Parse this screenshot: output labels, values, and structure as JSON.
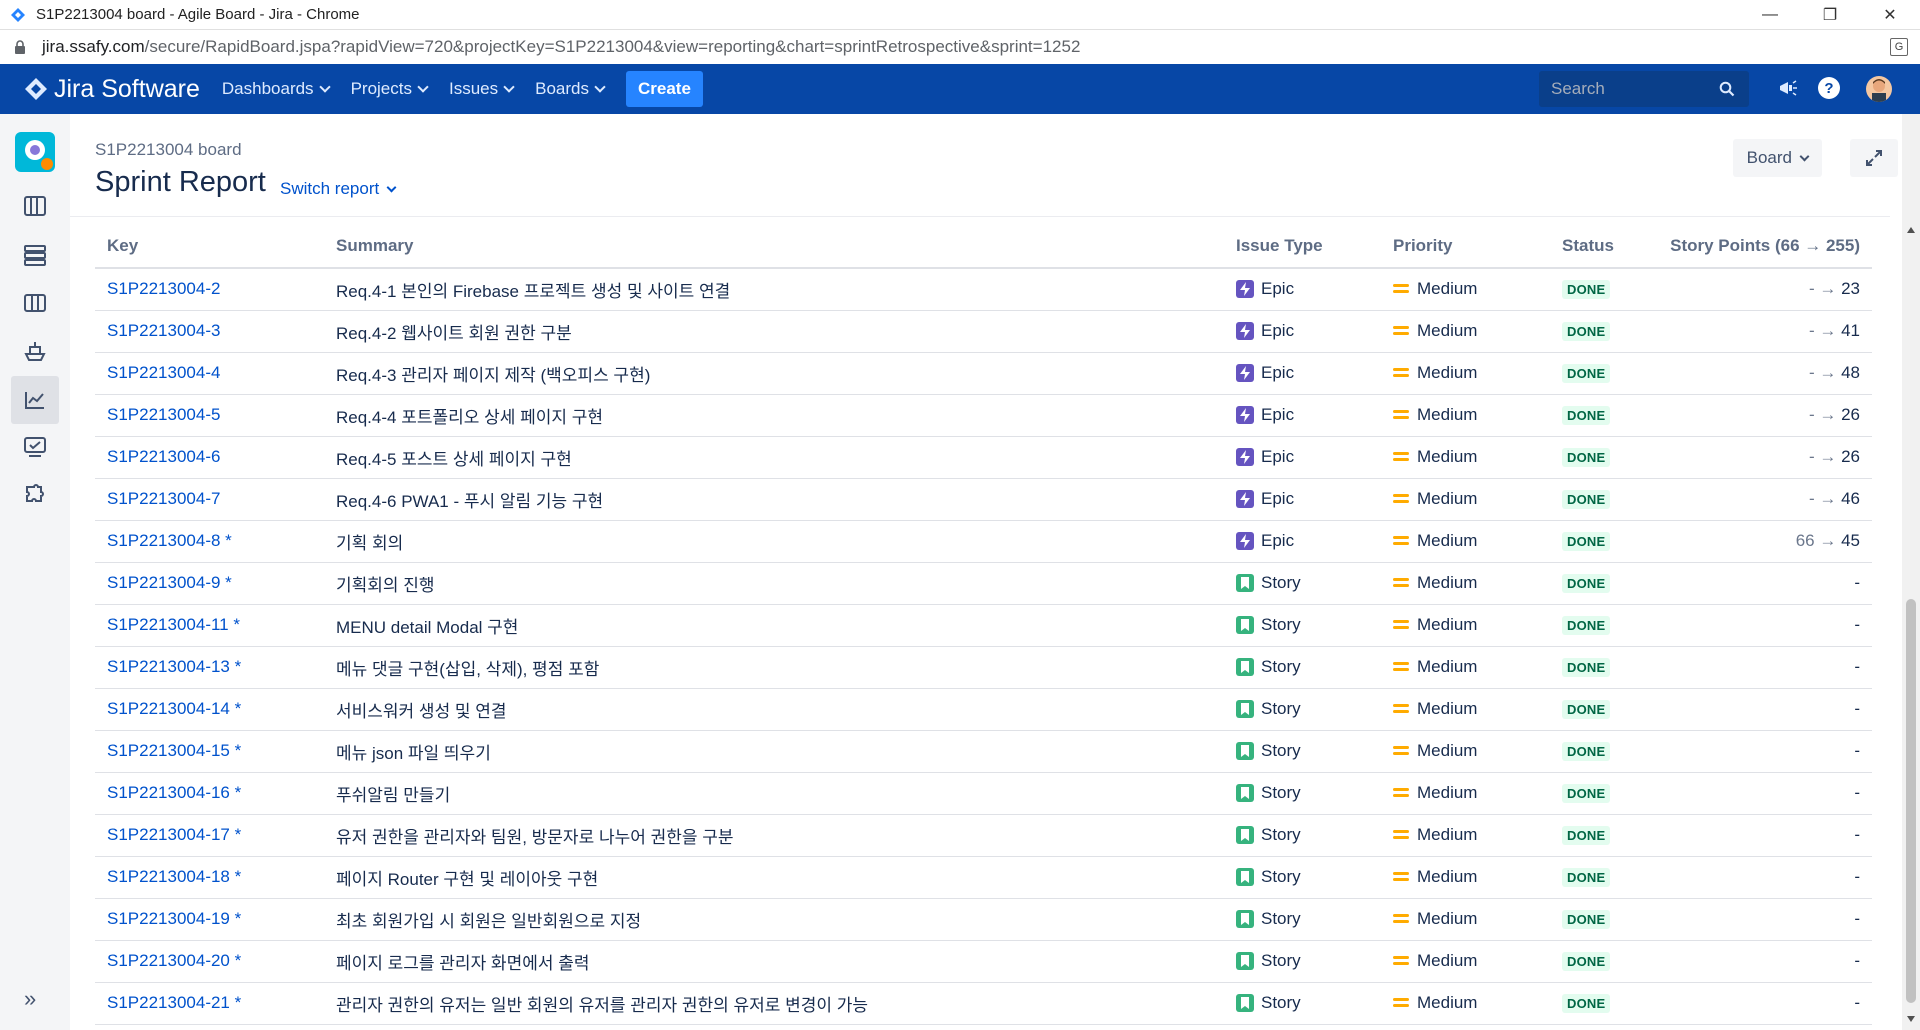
{
  "browser": {
    "window_title": "S1P2213004 board - Agile Board - Jira - Chrome",
    "url_domain": "jira.ssafy.com",
    "url_path": "/secure/RapidBoard.jspa?rapidView=720&projectKey=S1P2213004&view=reporting&chart=sprintRetrospective&sprint=1252"
  },
  "topnav": {
    "logo": "Jira Software",
    "items": [
      "Dashboards",
      "Projects",
      "Issues",
      "Boards"
    ],
    "create_label": "Create",
    "search_placeholder": "Search"
  },
  "header": {
    "board_name": "S1P2213004 board",
    "title": "Sprint Report",
    "switch_report": "Switch report",
    "board_button": "Board"
  },
  "table": {
    "columns": [
      "Key",
      "Summary",
      "Issue Type",
      "Priority",
      "Status",
      "Story Points (66 → 255)"
    ],
    "rows": [
      {
        "key": "S1P2213004-2",
        "summary": "Req.4-1 본인의 Firebase 프로젝트 생성 및 사이트 연결",
        "type": "Epic",
        "priority": "Medium",
        "status": "DONE",
        "points_from": "- →",
        "points_to": "23"
      },
      {
        "key": "S1P2213004-3",
        "summary": "Req.4-2 웹사이트 회원 권한 구분",
        "type": "Epic",
        "priority": "Medium",
        "status": "DONE",
        "points_from": "- →",
        "points_to": "41"
      },
      {
        "key": "S1P2213004-4",
        "summary": "Req.4-3 관리자 페이지 제작 (백오피스 구현)",
        "type": "Epic",
        "priority": "Medium",
        "status": "DONE",
        "points_from": "- →",
        "points_to": "48"
      },
      {
        "key": "S1P2213004-5",
        "summary": "Req.4-4 포트폴리오 상세 페이지 구현",
        "type": "Epic",
        "priority": "Medium",
        "status": "DONE",
        "points_from": "- →",
        "points_to": "26"
      },
      {
        "key": "S1P2213004-6",
        "summary": "Req.4-5 포스트 상세 페이지 구현",
        "type": "Epic",
        "priority": "Medium",
        "status": "DONE",
        "points_from": "- →",
        "points_to": "26"
      },
      {
        "key": "S1P2213004-7",
        "summary": "Req.4-6 PWA1 - 푸시 알림 기능 구현",
        "type": "Epic",
        "priority": "Medium",
        "status": "DONE",
        "points_from": "- →",
        "points_to": "46"
      },
      {
        "key": "S1P2213004-8 *",
        "summary": "기획 회의",
        "type": "Epic",
        "priority": "Medium",
        "status": "DONE",
        "points_from": "66 →",
        "points_to": "45"
      },
      {
        "key": "S1P2213004-9 *",
        "summary": "기획회의 진행",
        "type": "Story",
        "priority": "Medium",
        "status": "DONE",
        "points_from": "",
        "points_to": "-"
      },
      {
        "key": "S1P2213004-11 *",
        "summary": "MENU detail Modal 구현",
        "type": "Story",
        "priority": "Medium",
        "status": "DONE",
        "points_from": "",
        "points_to": "-"
      },
      {
        "key": "S1P2213004-13 *",
        "summary": "메뉴 댓글 구현(삽입, 삭제), 평점 포함",
        "type": "Story",
        "priority": "Medium",
        "status": "DONE",
        "points_from": "",
        "points_to": "-"
      },
      {
        "key": "S1P2213004-14 *",
        "summary": "서비스워커 생성 및 연결",
        "type": "Story",
        "priority": "Medium",
        "status": "DONE",
        "points_from": "",
        "points_to": "-"
      },
      {
        "key": "S1P2213004-15 *",
        "summary": "메뉴 json 파일 띄우기",
        "type": "Story",
        "priority": "Medium",
        "status": "DONE",
        "points_from": "",
        "points_to": "-"
      },
      {
        "key": "S1P2213004-16 *",
        "summary": "푸쉬알림 만들기",
        "type": "Story",
        "priority": "Medium",
        "status": "DONE",
        "points_from": "",
        "points_to": "-"
      },
      {
        "key": "S1P2213004-17 *",
        "summary": "유저 권한을 관리자와 팀원, 방문자로 나누어 권한을 구분",
        "type": "Story",
        "priority": "Medium",
        "status": "DONE",
        "points_from": "",
        "points_to": "-"
      },
      {
        "key": "S1P2213004-18 *",
        "summary": "페이지 Router 구현 및 레이아웃 구현",
        "type": "Story",
        "priority": "Medium",
        "status": "DONE",
        "points_from": "",
        "points_to": "-"
      },
      {
        "key": "S1P2213004-19 *",
        "summary": "최초 회원가입 시 회원은 일반회원으로 지정",
        "type": "Story",
        "priority": "Medium",
        "status": "DONE",
        "points_from": "",
        "points_to": "-"
      },
      {
        "key": "S1P2213004-20 *",
        "summary": "페이지 로그를 관리자 화면에서 출력",
        "type": "Story",
        "priority": "Medium",
        "status": "DONE",
        "points_from": "",
        "points_to": "-"
      },
      {
        "key": "S1P2213004-21 *",
        "summary": "관리자 권한의 유저는 일반 회원의 유저를 관리자 권한의 유저로 변경이 가능",
        "type": "Story",
        "priority": "Medium",
        "status": "DONE",
        "points_from": "",
        "points_to": "-"
      }
    ]
  },
  "colors": {
    "nav_bg": "#0747a6",
    "create_bg": "#2684ff",
    "link": "#0052cc",
    "epic": "#6554c0",
    "story": "#36b37e",
    "priority_medium": "#ffab00",
    "done_bg": "#e3fcef",
    "done_text": "#006644"
  }
}
